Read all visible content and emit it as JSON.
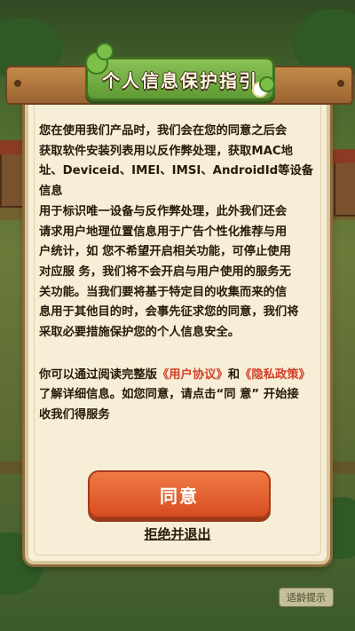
{
  "dialog": {
    "title": "个人信息保护指引",
    "paragraph1": [
      "您在使用我们产品时，我们会在您的同意之后会",
      "获取软件安装列表用以反作弊处理，获取MAC地",
      "址、Deviceid、IMEI、IMSI、AndroidId等设备信息",
      "用于标识唯一设备与反作弊处理，此外我们还会",
      "请求用户地理位置信息用于广告个性化推荐与用",
      "户统计，如 您不希望开启相关功能，可停止使用",
      "对应服 务，我们将不会开启与用户使用的服务无",
      "关功能。当我们要将基于特定目的收集而来的信",
      "息用于其他目的时，会事先征求您的同意，我们将",
      "采取必要措施保护您的个人信息安全。"
    ],
    "paragraph2": {
      "lead": "你可以通过阅读完整版",
      "user_agreement": "《用户协议》",
      "and": "和",
      "privacy_policy": "《隐私政策》",
      "line2": "了解详细信息。如您同意，请点击“同 意” 开始接",
      "line3": "收我们得服务"
    },
    "agree_label": "同意",
    "refuse_label": "拒绝并退出"
  },
  "background": {
    "age_tip": "适龄提示"
  },
  "colors": {
    "accent": "#d84d20",
    "link": "#d3412a",
    "panel": "#f6eed6",
    "title_sign": "#5f9a34"
  }
}
